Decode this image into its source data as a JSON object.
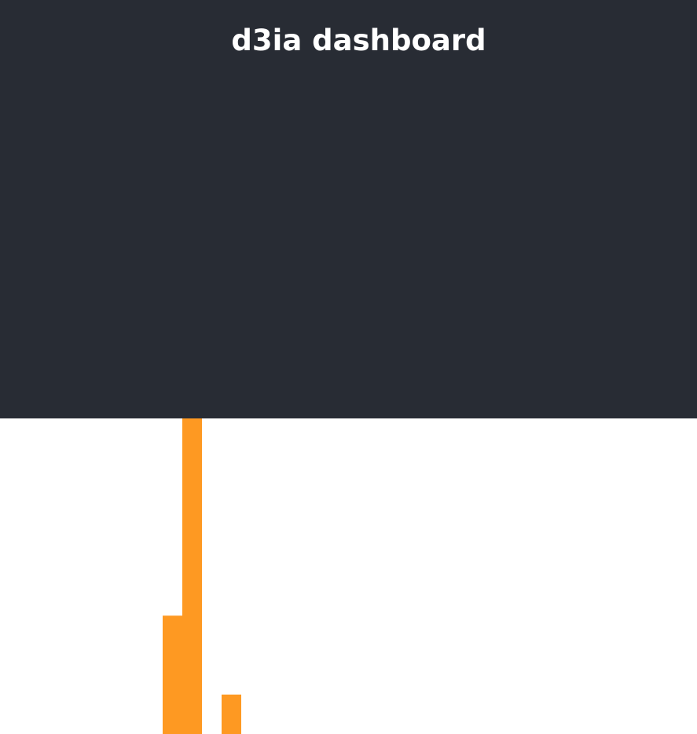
{
  "header": {
    "title": "d3ia dashboard",
    "background": "#282c34"
  },
  "chart_data": {
    "type": "bar",
    "bar_color": "#fe9922",
    "categories": [
      "",
      "",
      "",
      ""
    ],
    "values": [
      30,
      80,
      0,
      10
    ],
    "ylim": [
      0,
      80
    ],
    "title": "",
    "xlabel": "",
    "ylabel": "",
    "grid": false,
    "legend": "none"
  }
}
